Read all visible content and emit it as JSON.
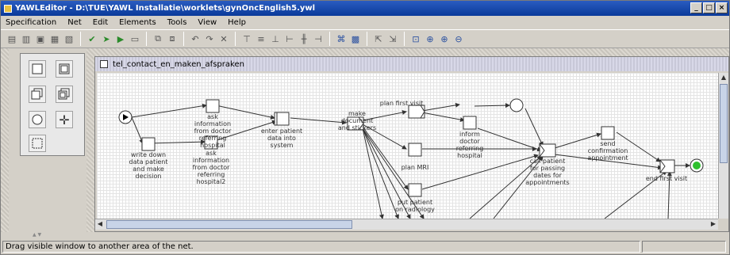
{
  "window": {
    "title": "YAWLEditor - D:\\TUE\\YAWL Installatie\\worklets\\gynOncEnglish5.ywl",
    "minimize": "_",
    "maximize": "□",
    "close": "×"
  },
  "menu": [
    "Specification",
    "Net",
    "Edit",
    "Elements",
    "Tools",
    "View",
    "Help"
  ],
  "net": {
    "title": "tel_contact_en_maken_afspraken",
    "tasks": [
      {
        "id": "t1",
        "label": [
          "ask",
          "information",
          "from doctor",
          "referring",
          "hospital"
        ]
      },
      {
        "id": "t2",
        "label": [
          "write down",
          "data patient",
          "and make",
          "decision"
        ]
      },
      {
        "id": "t3",
        "label": [
          "ask",
          "information",
          "from doctor",
          "referring",
          "hospital2"
        ]
      },
      {
        "id": "t4",
        "label": [
          "enter patient",
          "data into",
          "system"
        ]
      },
      {
        "id": "t5",
        "label": [
          "make",
          "document",
          "and stickers"
        ]
      },
      {
        "id": "t6",
        "label": [
          "plan first visit"
        ]
      },
      {
        "id": "t7",
        "label": [
          "inform",
          "doctor",
          "referring",
          "hospital"
        ]
      },
      {
        "id": "t8",
        "label": [
          "plan MRI"
        ]
      },
      {
        "id": "t9",
        "label": [
          "put patient",
          "on radiology"
        ]
      },
      {
        "id": "t10",
        "label": [
          "call patient",
          "for passing",
          "dates for",
          "appointments"
        ]
      },
      {
        "id": "t11",
        "label": [
          "send",
          "confirmation",
          "appointment"
        ]
      },
      {
        "id": "t12",
        "label": [
          "end first visit"
        ]
      }
    ]
  },
  "status": {
    "message": "Drag visible window to another area of the net.",
    "secondary": ""
  },
  "colors": {
    "titlebar": "#0a3a9a",
    "end_condition": "#2ec02e",
    "canvas": "#ffffff"
  }
}
